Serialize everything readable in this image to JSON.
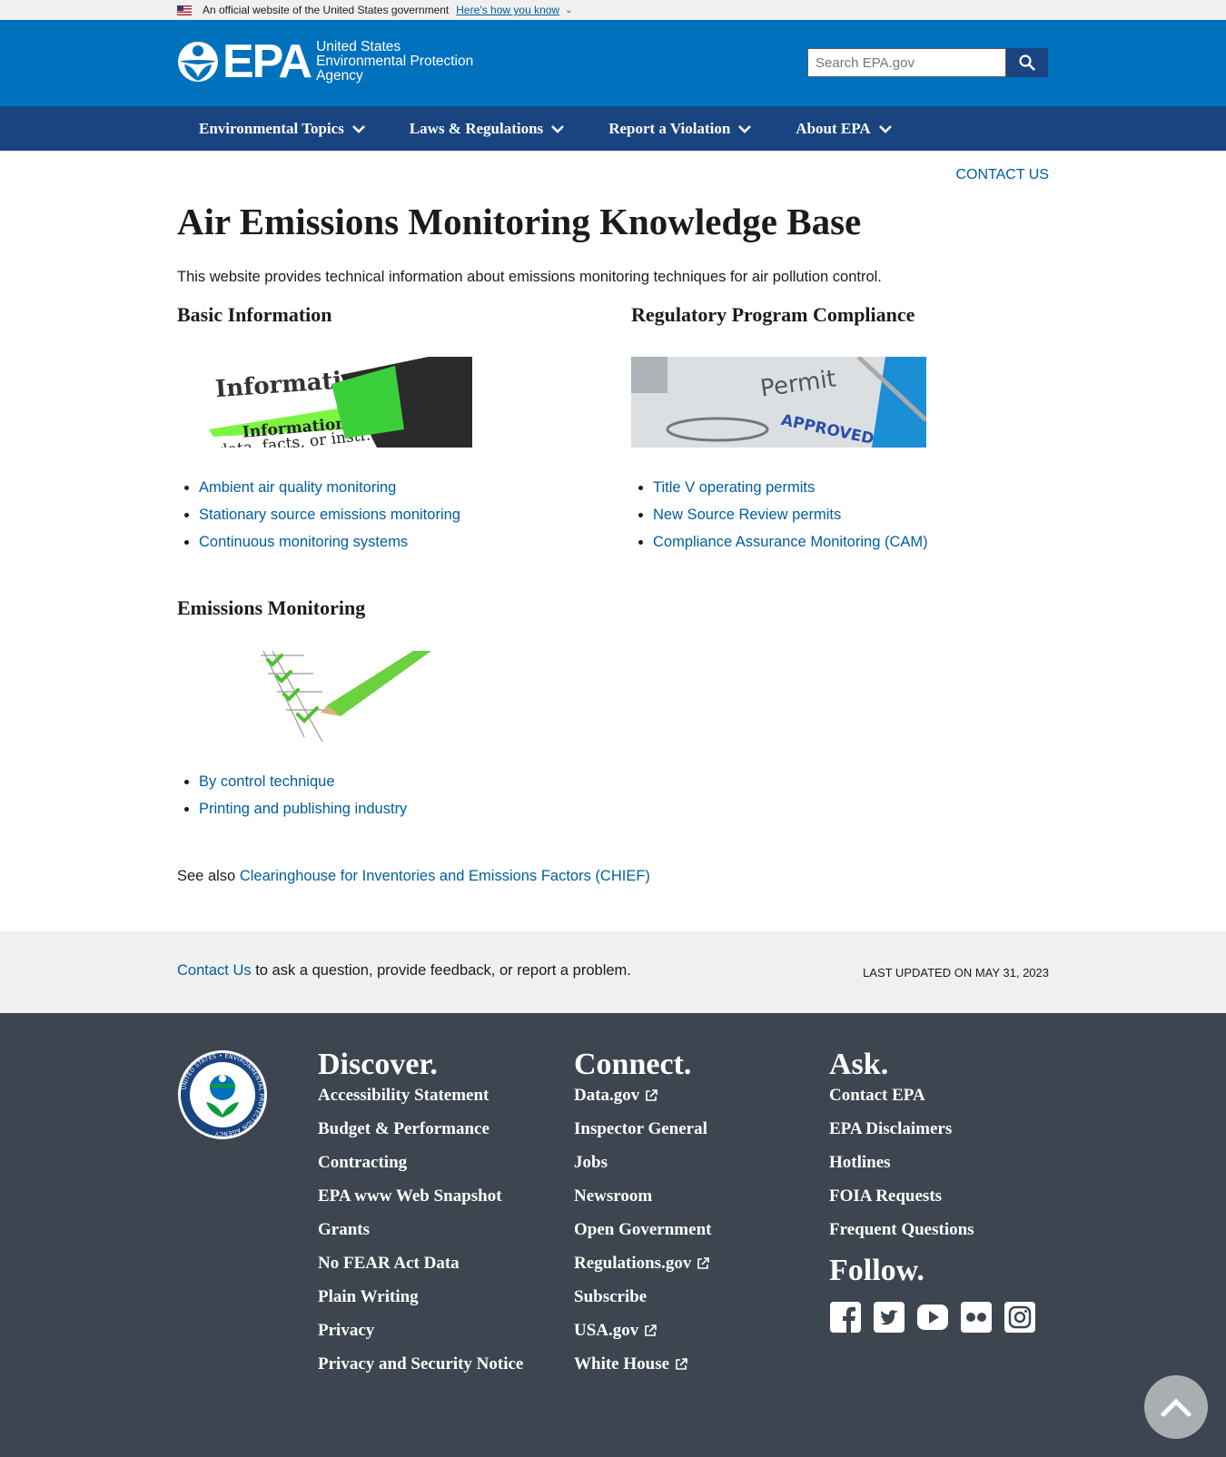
{
  "gov_banner": {
    "text": "An official website of the United States government",
    "link": "Here’s how you know"
  },
  "header": {
    "logo_text": "EPA",
    "agency_lines": [
      "United States",
      "Environmental Protection",
      "Agency"
    ],
    "search_placeholder": "Search EPA.gov"
  },
  "nav": [
    "Environmental Topics",
    "Laws & Regulations",
    "Report a Violation",
    "About EPA"
  ],
  "main": {
    "contact_link": "CONTACT US",
    "title": "Air Emissions Monitoring Knowledge Base",
    "intro": "This website provides technical information about emissions monitoring techniques for air pollution control.",
    "sections": [
      {
        "heading": "Basic Information",
        "links": [
          "Ambient air quality monitoring",
          "Stationary source emissions monitoring",
          "Continuous monitoring systems"
        ]
      },
      {
        "heading": "Regulatory Program Compliance",
        "links": [
          "Title V operating permits",
          "New Source Review permits",
          "Compliance Assurance Monitoring (CAM)"
        ]
      },
      {
        "heading": "Emissions Monitoring",
        "links": [
          "By control technique",
          "Printing and publishing industry"
        ]
      }
    ],
    "image_text": {
      "info_top": "Information",
      "info_mid": "Information",
      "info_bottom": "data, facts, or instr...obtained from",
      "permit": "Permit",
      "approved": "APPROVED"
    },
    "see_also_prefix": "See also",
    "see_also_link": "Clearinghouse for Inventories and Emissions Factors (CHIEF)"
  },
  "feedback": {
    "contact_link": "Contact Us",
    "text": " to ask a question, provide feedback, or report a problem.",
    "updated": "LAST UPDATED ON MAY 31, 2023"
  },
  "footer": {
    "seal_text": "UNITED STATES • ENVIRONMENTAL PROTECTION AGENCY",
    "discover": {
      "heading": "Discover.",
      "items": [
        "Accessibility Statement",
        "Budget & Performance",
        "Contracting",
        "EPA www Web Snapshot",
        "Grants",
        "No FEAR Act Data",
        "Plain Writing",
        "Privacy",
        "Privacy and Security Notice"
      ]
    },
    "connect": {
      "heading": "Connect.",
      "items": [
        "Data.gov",
        "Inspector General",
        "Jobs",
        "Newsroom",
        "Open Government",
        "Regulations.gov",
        "Subscribe",
        "USA.gov",
        "White House"
      ]
    },
    "ask": {
      "heading": "Ask.",
      "items": [
        "Contact EPA",
        "EPA Disclaimers",
        "Hotlines",
        "FOIA Requests",
        "Frequent Questions"
      ]
    },
    "follow": {
      "heading": "Follow.",
      "icons": [
        "facebook-icon",
        "twitter-icon",
        "youtube-icon",
        "flickr-icon",
        "instagram-icon"
      ]
    }
  },
  "colors": {
    "header_blue": "#0071bc",
    "nav_blue": "#1a4480",
    "link": "#005ea2",
    "footer_bg": "#3d4551",
    "feedback_bg": "#f0f0f0"
  }
}
